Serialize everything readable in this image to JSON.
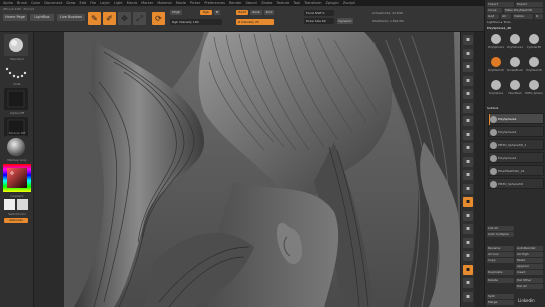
{
  "menu": [
    "Alpha",
    "Brush",
    "Color",
    "Document",
    "Draw",
    "Edit",
    "File",
    "Layer",
    "Light",
    "Macro",
    "Marker",
    "Material",
    "Movie",
    "Picker",
    "Preferences",
    "Render",
    "Stencil",
    "Stroke",
    "Texture",
    "Tool",
    "Transform",
    "Zplugin",
    "Zscript"
  ],
  "shelf": {
    "info": "ZBrush 4R8 · ZScript",
    "home_page": "Home Page",
    "lightbox": "LightBox",
    "live_boolean": "Live Boolean",
    "edit": "Edit",
    "draw": "Draw",
    "move": "Move",
    "scale": "Scale",
    "rotate": "Rotate",
    "mrgb": "Mrgb",
    "rgb": "Rgb",
    "m": "M",
    "rgb_intensity": "Rgb Intensity 100",
    "zadd": "Zadd",
    "zsub": "Zsub",
    "zcut": "Zcut",
    "focal_shift": "Focal Shift 0",
    "z_intensity": "Z Intensity 25",
    "draw_size": "Draw Size 64",
    "dynamic": "Dynamic",
    "active_points": "ActivePoints: 22,846",
    "total_points": "TotalPoints: 1.842 Mil"
  },
  "left_tray": {
    "brush_label": "Standard",
    "stroke_label": "Dots",
    "alpha_label": "Alpha Off",
    "texture_label": "Texture Off",
    "material_label": "MatCap Gray",
    "gradient_label": "Gradient",
    "switch_color_label": "SwitchColor",
    "alternate_label": "Alternate"
  },
  "right_icons": [
    "BPR",
    "SPix",
    "Scroll",
    "Zoom",
    "Actual",
    "AAHalf",
    "Persp",
    "Floor",
    "Local",
    "LSym",
    "Frame",
    "Move",
    "Scale",
    "Rotate",
    "Line Fill",
    "PolyF",
    "Transp",
    "Ghost",
    "Solo",
    "Xpose"
  ],
  "right_panel": {
    "import": "Import",
    "export": "Export",
    "clone": "Clone",
    "make_polymesh": "Make PolyMesh3D",
    "goz": "GoZ",
    "all": "All",
    "visible": "Visible",
    "r": "R",
    "lightbox_tools": "Lightbox ▸ Tools",
    "current_tool": "PolySphere1_48",
    "tool_thumbs": [
      "PolySphere1",
      "PolySphere1",
      "Cylinder3D",
      "PolyMesh3D",
      "SimpleBrush",
      "PolyMesh3D",
      "PolySphere",
      "FiberMesh",
      "PM3D_Sphere3D"
    ],
    "subtool_header": "Subtool",
    "subtools": [
      "PolySphere1",
      "PolySphere1",
      "PM3D_Sphere3D_1",
      "PolySphere1",
      "FiberMeshHair_01",
      "PM3D_Sphere3D"
    ],
    "list_all": "List All",
    "auto_collapse": "Auto Collapse",
    "rename": "Rename",
    "autoreorder": "AutoReorder",
    "all_low": "All Low",
    "all_high": "All High",
    "copy": "Copy",
    "paste": "Paste",
    "append": "Append",
    "duplicate": "Duplicate",
    "insert": "Insert",
    "delete": "Delete",
    "del_other": "Del Other",
    "del_all": "Del All",
    "split": "Split",
    "merge": "Merge"
  },
  "watermark": "Linkedin"
}
